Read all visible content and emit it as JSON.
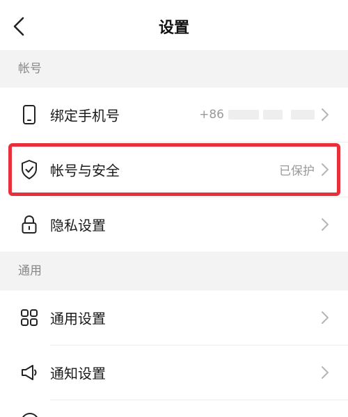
{
  "header": {
    "title": "设置",
    "back_icon": "chevron-left-icon"
  },
  "sections": {
    "account": {
      "title": "帐号",
      "items": [
        {
          "label": "绑定手机号",
          "value": "+86",
          "icon": "phone-icon"
        },
        {
          "label": "帐号与安全",
          "value": "已保护",
          "icon": "shield-check-icon"
        },
        {
          "label": "隐私设置",
          "value": "",
          "icon": "lock-icon"
        }
      ]
    },
    "general": {
      "title": "通用",
      "items": [
        {
          "label": "通用设置",
          "value": "",
          "icon": "grid-icon"
        },
        {
          "label": "通知设置",
          "value": "",
          "icon": "speaker-icon"
        }
      ]
    }
  },
  "colors": {
    "highlight": "#e8303a",
    "section_bg": "#f3f3f3",
    "muted_text": "#999999"
  }
}
